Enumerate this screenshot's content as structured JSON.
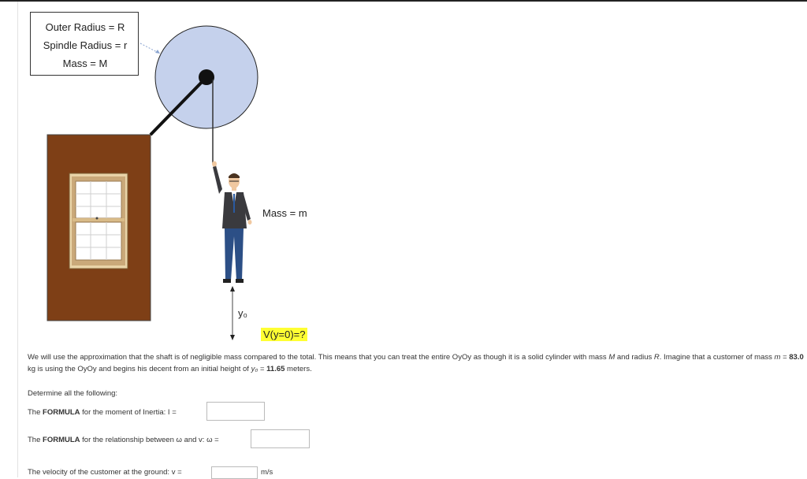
{
  "infobox": {
    "line1": "Outer Radius = R",
    "line2": "Spindle Radius = r",
    "line3": "Mass = M"
  },
  "figure": {
    "person_mass_label": "Mass = m",
    "height_label": "y₀",
    "velocity_label": "V(y=0)=?"
  },
  "colors": {
    "wheel": "#c5d1ec",
    "wall": "#7e3f16",
    "velocity_highlight": "#ffff33"
  },
  "text": {
    "intro_1": "We will use the approximation that the shaft is of negligible mass compared to the total. This means that you can treat the entire OyOy as though it is a solid cylinder with mass ",
    "intro_M": "M",
    "intro_2": " and radius ",
    "intro_R": "R",
    "intro_3": ". Imagine that a customer of mass ",
    "intro_m": "m",
    "intro_4": " = ",
    "mass_value": "83.0",
    "intro_5": " kg is using the OyOy and begins his decent from an initial height of ",
    "intro_y0": "y₀",
    "intro_6": " = ",
    "height_value": "11.65",
    "intro_7": " meters.",
    "determine": "Determine all the following:"
  },
  "questions": {
    "inertia_prefix": "The ",
    "inertia_bold": "FORMULA",
    "inertia_suffix": " for the moment of Inertia: I =",
    "relation_prefix": "The ",
    "relation_bold": "FORMULA",
    "relation_suffix": " for the relationship between ω and v: ω =",
    "velocity_prefix": "The velocity of the customer at the ground: v =",
    "velocity_unit": "m/s"
  }
}
